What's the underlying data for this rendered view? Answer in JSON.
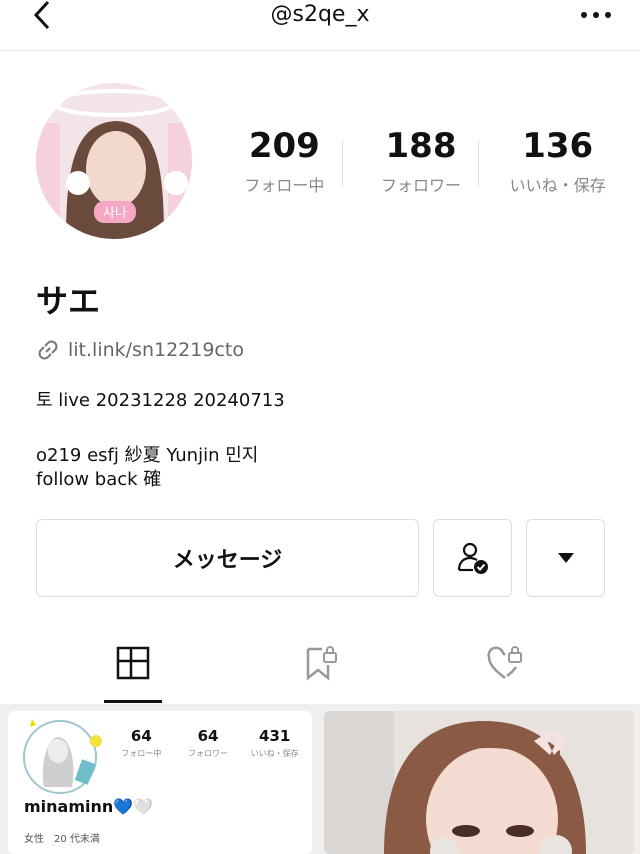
{
  "header": {
    "title": "@s2qe_x"
  },
  "profile": {
    "name": "サエ",
    "link": "lit.link/sn12219cto",
    "bio_lines": [
      "토 live 20231228 20240713",
      "o219 esfj 紗夏 Yunjin 민지",
      "follow back 確"
    ],
    "avatar_sticker_text": "사나"
  },
  "stats": [
    {
      "value": "209",
      "label": "フォロー中"
    },
    {
      "value": "188",
      "label": "フォロワー"
    },
    {
      "value": "136",
      "label": "いいね・保存"
    }
  ],
  "actions": {
    "message_label": "メッセージ"
  },
  "tiles": {
    "left": {
      "stats": [
        {
          "value": "64",
          "label": "フォロー中"
        },
        {
          "value": "64",
          "label": "フォロワー"
        },
        {
          "value": "431",
          "label": "いいね・保存"
        }
      ],
      "name": "minaminn💙🤍",
      "meta": "女性　20 代未満"
    }
  },
  "colors": {
    "accent": "#111111",
    "muted": "#888888",
    "border": "#dcdcdc"
  }
}
